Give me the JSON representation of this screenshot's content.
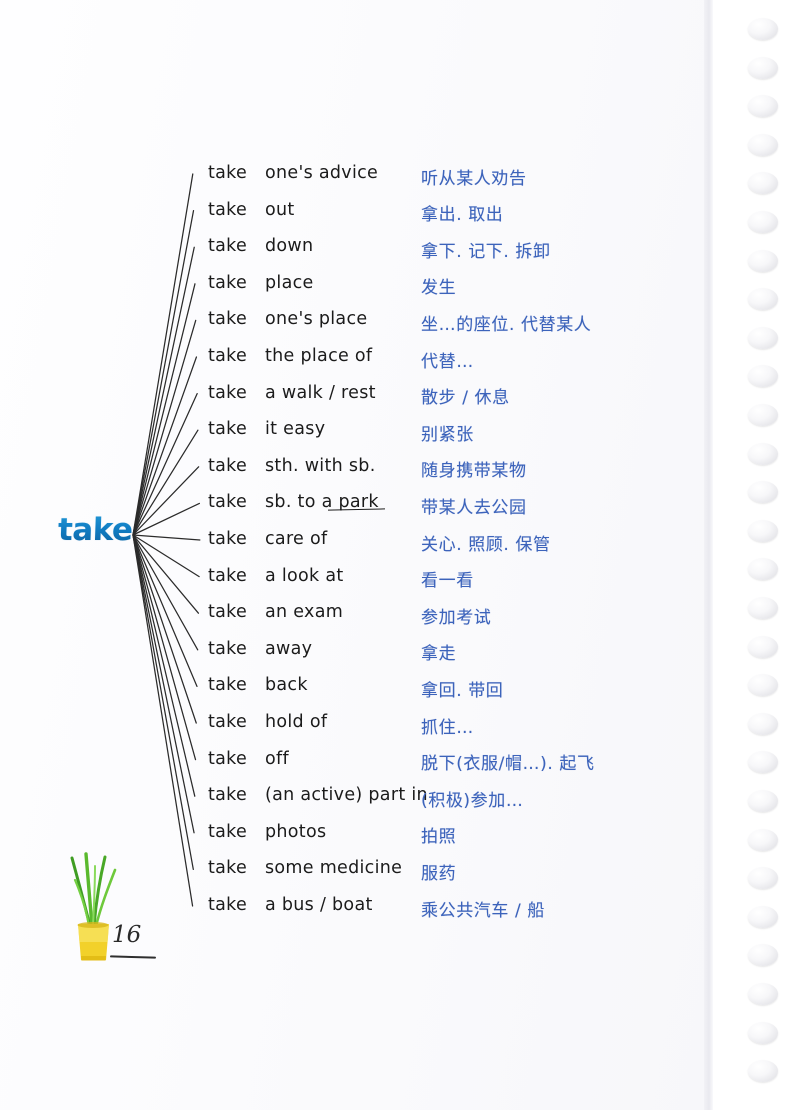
{
  "page": {
    "headword": "take",
    "page_number": "16",
    "accent_color": "#1180c6",
    "translation_color": "#3c63bb",
    "ink_color": "#1b1b1b"
  },
  "entries": [
    {
      "verb": "take",
      "phrase": "one's advice",
      "translation": "听从某人劝告"
    },
    {
      "verb": "take",
      "phrase": "out",
      "translation": "拿出. 取出"
    },
    {
      "verb": "take",
      "phrase": "down",
      "translation": "拿下. 记下. 拆卸"
    },
    {
      "verb": "take",
      "phrase": "place",
      "translation": "发生"
    },
    {
      "verb": "take",
      "phrase": "one's place",
      "translation": "坐…的座位. 代替某人"
    },
    {
      "verb": "take",
      "phrase": "the place of",
      "translation": "代替…"
    },
    {
      "verb": "take",
      "phrase": "a walk / rest",
      "translation": "散步 / 休息"
    },
    {
      "verb": "take",
      "phrase": "it easy",
      "translation": "别紧张"
    },
    {
      "verb": "take",
      "phrase": "sth. with sb.",
      "translation": "随身携带某物"
    },
    {
      "verb": "take",
      "phrase": "sb. to a park",
      "translation": "带某人去公园"
    },
    {
      "verb": "take",
      "phrase": "care of",
      "translation": "关心. 照顾. 保管"
    },
    {
      "verb": "take",
      "phrase": "a look at",
      "translation": "看一看"
    },
    {
      "verb": "take",
      "phrase": "an exam",
      "translation": "参加考试"
    },
    {
      "verb": "take",
      "phrase": "away",
      "translation": "拿走"
    },
    {
      "verb": "take",
      "phrase": "back",
      "translation": "拿回. 带回"
    },
    {
      "verb": "take",
      "phrase": "hold of",
      "translation": "抓住…"
    },
    {
      "verb": "take",
      "phrase": "off",
      "translation": "脱下(衣服/帽…). 起飞"
    },
    {
      "verb": "take",
      "phrase": "(an active) part in",
      "translation": "(积极)参加…"
    },
    {
      "verb": "take",
      "phrase": "photos",
      "translation": "拍照"
    },
    {
      "verb": "take",
      "phrase": "some medicine",
      "translation": "服药"
    },
    {
      "verb": "take",
      "phrase": "a bus / boat",
      "translation": "乘公共汽车 / 船"
    }
  ],
  "binding": {
    "ring_count": 28,
    "label": "spiral-ring"
  }
}
